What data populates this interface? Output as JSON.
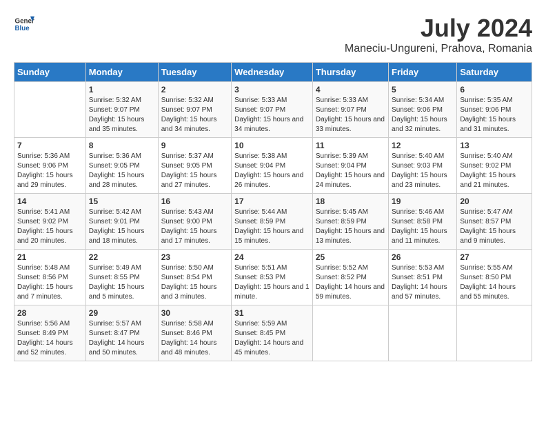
{
  "header": {
    "logo": {
      "general": "General",
      "blue": "Blue"
    },
    "title": "July 2024",
    "subtitle": "Maneciu-Ungureni, Prahova, Romania"
  },
  "calendar": {
    "days_of_week": [
      "Sunday",
      "Monday",
      "Tuesday",
      "Wednesday",
      "Thursday",
      "Friday",
      "Saturday"
    ],
    "weeks": [
      [
        {
          "day": "",
          "sunrise": "",
          "sunset": "",
          "daylight": ""
        },
        {
          "day": "1",
          "sunrise": "Sunrise: 5:32 AM",
          "sunset": "Sunset: 9:07 PM",
          "daylight": "Daylight: 15 hours and 35 minutes."
        },
        {
          "day": "2",
          "sunrise": "Sunrise: 5:32 AM",
          "sunset": "Sunset: 9:07 PM",
          "daylight": "Daylight: 15 hours and 34 minutes."
        },
        {
          "day": "3",
          "sunrise": "Sunrise: 5:33 AM",
          "sunset": "Sunset: 9:07 PM",
          "daylight": "Daylight: 15 hours and 34 minutes."
        },
        {
          "day": "4",
          "sunrise": "Sunrise: 5:33 AM",
          "sunset": "Sunset: 9:07 PM",
          "daylight": "Daylight: 15 hours and 33 minutes."
        },
        {
          "day": "5",
          "sunrise": "Sunrise: 5:34 AM",
          "sunset": "Sunset: 9:06 PM",
          "daylight": "Daylight: 15 hours and 32 minutes."
        },
        {
          "day": "6",
          "sunrise": "Sunrise: 5:35 AM",
          "sunset": "Sunset: 9:06 PM",
          "daylight": "Daylight: 15 hours and 31 minutes."
        }
      ],
      [
        {
          "day": "7",
          "sunrise": "Sunrise: 5:36 AM",
          "sunset": "Sunset: 9:06 PM",
          "daylight": "Daylight: 15 hours and 29 minutes."
        },
        {
          "day": "8",
          "sunrise": "Sunrise: 5:36 AM",
          "sunset": "Sunset: 9:05 PM",
          "daylight": "Daylight: 15 hours and 28 minutes."
        },
        {
          "day": "9",
          "sunrise": "Sunrise: 5:37 AM",
          "sunset": "Sunset: 9:05 PM",
          "daylight": "Daylight: 15 hours and 27 minutes."
        },
        {
          "day": "10",
          "sunrise": "Sunrise: 5:38 AM",
          "sunset": "Sunset: 9:04 PM",
          "daylight": "Daylight: 15 hours and 26 minutes."
        },
        {
          "day": "11",
          "sunrise": "Sunrise: 5:39 AM",
          "sunset": "Sunset: 9:04 PM",
          "daylight": "Daylight: 15 hours and 24 minutes."
        },
        {
          "day": "12",
          "sunrise": "Sunrise: 5:40 AM",
          "sunset": "Sunset: 9:03 PM",
          "daylight": "Daylight: 15 hours and 23 minutes."
        },
        {
          "day": "13",
          "sunrise": "Sunrise: 5:40 AM",
          "sunset": "Sunset: 9:02 PM",
          "daylight": "Daylight: 15 hours and 21 minutes."
        }
      ],
      [
        {
          "day": "14",
          "sunrise": "Sunrise: 5:41 AM",
          "sunset": "Sunset: 9:02 PM",
          "daylight": "Daylight: 15 hours and 20 minutes."
        },
        {
          "day": "15",
          "sunrise": "Sunrise: 5:42 AM",
          "sunset": "Sunset: 9:01 PM",
          "daylight": "Daylight: 15 hours and 18 minutes."
        },
        {
          "day": "16",
          "sunrise": "Sunrise: 5:43 AM",
          "sunset": "Sunset: 9:00 PM",
          "daylight": "Daylight: 15 hours and 17 minutes."
        },
        {
          "day": "17",
          "sunrise": "Sunrise: 5:44 AM",
          "sunset": "Sunset: 8:59 PM",
          "daylight": "Daylight: 15 hours and 15 minutes."
        },
        {
          "day": "18",
          "sunrise": "Sunrise: 5:45 AM",
          "sunset": "Sunset: 8:59 PM",
          "daylight": "Daylight: 15 hours and 13 minutes."
        },
        {
          "day": "19",
          "sunrise": "Sunrise: 5:46 AM",
          "sunset": "Sunset: 8:58 PM",
          "daylight": "Daylight: 15 hours and 11 minutes."
        },
        {
          "day": "20",
          "sunrise": "Sunrise: 5:47 AM",
          "sunset": "Sunset: 8:57 PM",
          "daylight": "Daylight: 15 hours and 9 minutes."
        }
      ],
      [
        {
          "day": "21",
          "sunrise": "Sunrise: 5:48 AM",
          "sunset": "Sunset: 8:56 PM",
          "daylight": "Daylight: 15 hours and 7 minutes."
        },
        {
          "day": "22",
          "sunrise": "Sunrise: 5:49 AM",
          "sunset": "Sunset: 8:55 PM",
          "daylight": "Daylight: 15 hours and 5 minutes."
        },
        {
          "day": "23",
          "sunrise": "Sunrise: 5:50 AM",
          "sunset": "Sunset: 8:54 PM",
          "daylight": "Daylight: 15 hours and 3 minutes."
        },
        {
          "day": "24",
          "sunrise": "Sunrise: 5:51 AM",
          "sunset": "Sunset: 8:53 PM",
          "daylight": "Daylight: 15 hours and 1 minute."
        },
        {
          "day": "25",
          "sunrise": "Sunrise: 5:52 AM",
          "sunset": "Sunset: 8:52 PM",
          "daylight": "Daylight: 14 hours and 59 minutes."
        },
        {
          "day": "26",
          "sunrise": "Sunrise: 5:53 AM",
          "sunset": "Sunset: 8:51 PM",
          "daylight": "Daylight: 14 hours and 57 minutes."
        },
        {
          "day": "27",
          "sunrise": "Sunrise: 5:55 AM",
          "sunset": "Sunset: 8:50 PM",
          "daylight": "Daylight: 14 hours and 55 minutes."
        }
      ],
      [
        {
          "day": "28",
          "sunrise": "Sunrise: 5:56 AM",
          "sunset": "Sunset: 8:49 PM",
          "daylight": "Daylight: 14 hours and 52 minutes."
        },
        {
          "day": "29",
          "sunrise": "Sunrise: 5:57 AM",
          "sunset": "Sunset: 8:47 PM",
          "daylight": "Daylight: 14 hours and 50 minutes."
        },
        {
          "day": "30",
          "sunrise": "Sunrise: 5:58 AM",
          "sunset": "Sunset: 8:46 PM",
          "daylight": "Daylight: 14 hours and 48 minutes."
        },
        {
          "day": "31",
          "sunrise": "Sunrise: 5:59 AM",
          "sunset": "Sunset: 8:45 PM",
          "daylight": "Daylight: 14 hours and 45 minutes."
        },
        {
          "day": "",
          "sunrise": "",
          "sunset": "",
          "daylight": ""
        },
        {
          "day": "",
          "sunrise": "",
          "sunset": "",
          "daylight": ""
        },
        {
          "day": "",
          "sunrise": "",
          "sunset": "",
          "daylight": ""
        }
      ]
    ]
  }
}
